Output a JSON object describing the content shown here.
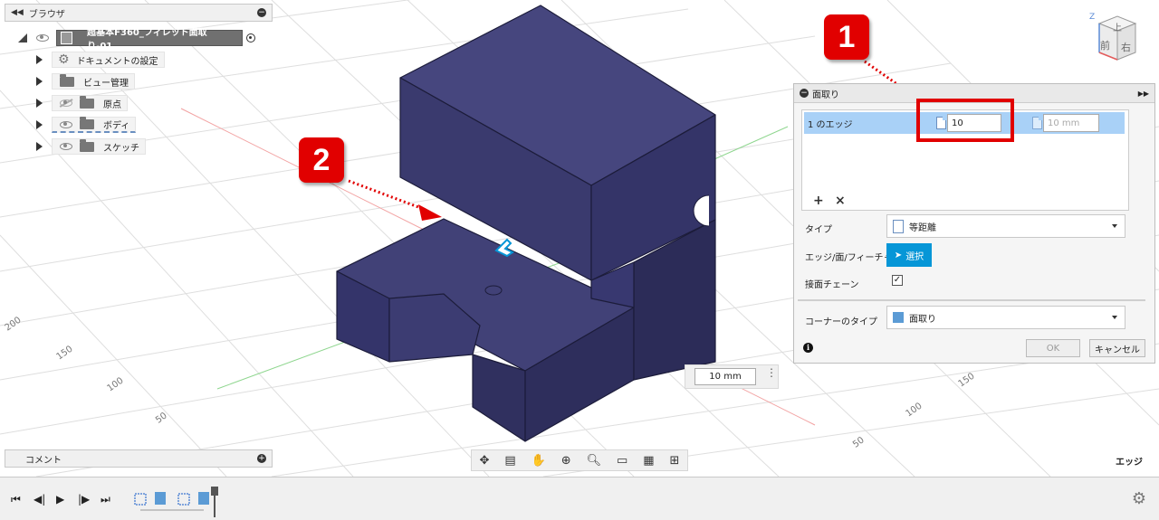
{
  "browser": {
    "title": "ブラウザ",
    "collapse_icon": "double-left-arrow-icon",
    "root": {
      "name": "超基本F360_フィレット面取り-01_..."
    },
    "items": [
      {
        "label": "ドキュメントの設定",
        "icon": "gear-icon",
        "eye": "none"
      },
      {
        "label": "ビュー管理",
        "icon": "folder-icon",
        "eye": "none"
      },
      {
        "label": "原点",
        "icon": "folder-icon",
        "eye": "hidden"
      },
      {
        "label": "ボディ",
        "icon": "folder-icon",
        "eye": "visible"
      },
      {
        "label": "スケッチ",
        "icon": "folder-icon",
        "eye": "visible"
      }
    ]
  },
  "comment": {
    "label": "コメント"
  },
  "dialog": {
    "title": "面取り",
    "selection_label": "1 のエッジ",
    "distance_value": "10",
    "distance_placeholder": "10 mm",
    "type_label": "タイプ",
    "type_value": "等距離",
    "edge_label": "エッジ/面/フィーチャ",
    "select_button": "選択",
    "chain_label": "接面チェーン",
    "chain_checked": "✓",
    "corner_label": "コーナーのタイプ",
    "corner_value": "面取り",
    "ok": "OK",
    "cancel": "キャンセル"
  },
  "canvas": {
    "distance_input": "10 mm",
    "grid_labels": [
      "200",
      "150",
      "100",
      "50",
      "150",
      "100",
      "50"
    ],
    "status_hint": "エッジ"
  },
  "viewcube": {
    "top": "上",
    "front": "前",
    "right": "右",
    "axis": "Z"
  },
  "callouts": [
    "1",
    "2"
  ],
  "colors": {
    "body": "#3a3a6e",
    "accent": "#0696d7",
    "callout": "#e10000"
  }
}
